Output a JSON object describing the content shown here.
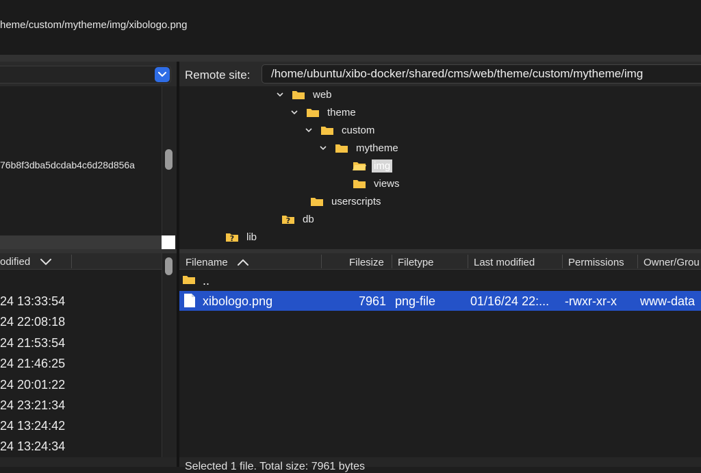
{
  "log": {
    "line": "heme/custom/mytheme/img/xibologo.png"
  },
  "local": {
    "tree_visible_text": "76b8f3dba5dcdab4c6d28d856a",
    "columns": {
      "modified": "odified"
    },
    "rows": [
      "24 13:33:54",
      "24 22:08:18",
      "24 21:53:54",
      "24 21:46:25",
      "24 20:01:22",
      "24 23:21:34",
      "24 13:24:42",
      "24 13:24:34"
    ]
  },
  "remote": {
    "label": "Remote site:",
    "path": "/home/ubuntu/xibo-docker/shared/cms/web/theme/custom/mytheme/img",
    "tree": {
      "web": "web",
      "theme": "theme",
      "custom": "custom",
      "mytheme": "mytheme",
      "img": "img",
      "views": "views",
      "userscripts": "userscripts",
      "db": "db",
      "lib": "lib"
    },
    "columns": {
      "filename": "Filename",
      "filesize": "Filesize",
      "filetype": "Filetype",
      "modified": "Last modified",
      "permissions": "Permissions",
      "owner": "Owner/Grou"
    },
    "parent_entry": "..",
    "files": [
      {
        "name": "xibologo.png",
        "size": "7961",
        "type": "png-file",
        "modified": "01/16/24 22:...",
        "permissions": "-rwxr-xr-x",
        "owner": "www-data"
      }
    ]
  },
  "status": {
    "text": "Selected 1 file. Total size: 7961 bytes"
  },
  "colors": {
    "selection": "#2452c8",
    "folder": "#f6c344",
    "accent_button": "#2f6de6"
  }
}
